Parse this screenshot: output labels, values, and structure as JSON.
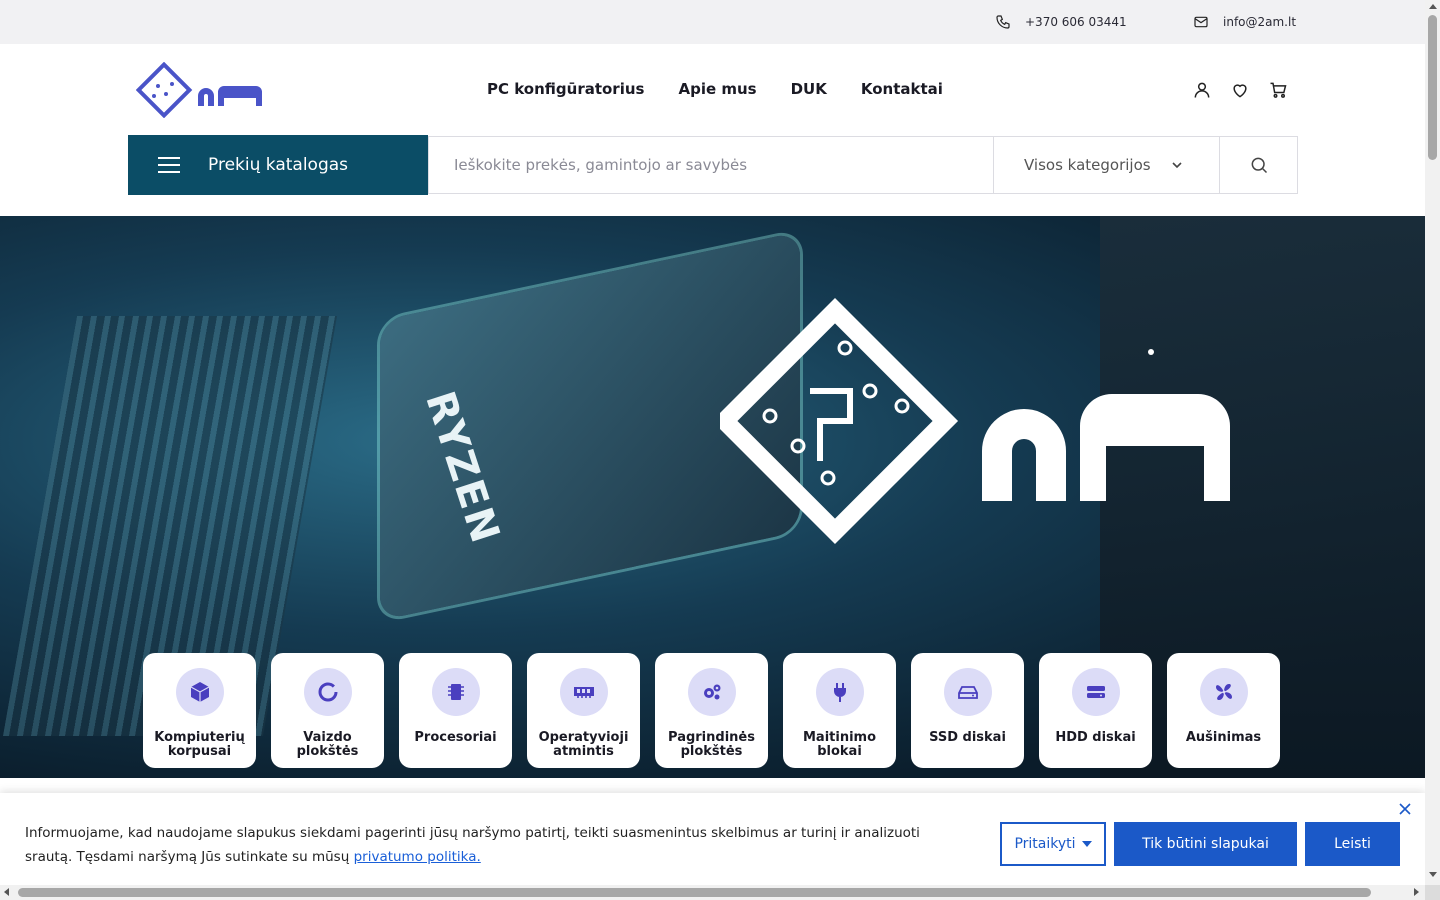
{
  "topbar": {
    "phone": "+370 606 03441",
    "email": "info@2am.lt"
  },
  "header": {
    "nav": [
      "PC konfigūratorius",
      "Apie mus",
      "DUK",
      "Kontaktai"
    ],
    "catalog_label": "Prekių katalogas",
    "search_placeholder": "Ieškokite prekės, gamintojo ar savybės",
    "category_selected": "Visos kategorijos"
  },
  "hero": {
    "cpu_text": "RYZEN"
  },
  "categories": [
    {
      "label": "Kompiuterių korpusai",
      "icon": "cube-icon"
    },
    {
      "label": "Vaizdo plokštės",
      "icon": "ring-icon"
    },
    {
      "label": "Procesoriai",
      "icon": "chip-icon"
    },
    {
      "label": "Operatyvioji atmintis",
      "icon": "ram-icon"
    },
    {
      "label": "Pagrindinės plokštės",
      "icon": "gears-icon"
    },
    {
      "label": "Maitinimo blokai",
      "icon": "plug-icon"
    },
    {
      "label": "SSD diskai",
      "icon": "drive-icon"
    },
    {
      "label": "HDD diskai",
      "icon": "hdd-icon"
    },
    {
      "label": "Aušinimas",
      "icon": "fan-icon"
    }
  ],
  "cookie": {
    "text": "Informuojame, kad naudojame slapukus siekdami pagerinti jūsų naršymo patirtį, teikti suasmenintus skelbimus ar turinį ir analizuoti srautą. Tęsdami naršymą Jūs sutinkate su mūsų",
    "link": "privatumo politika.",
    "customize": "Pritaikyti",
    "essential": "Tik būtini slapukai",
    "allow": "Leisti"
  },
  "colors": {
    "brand": "#0b4d66",
    "accent": "#1b59c8",
    "icon_bg": "#dcdcf7",
    "icon_fg": "#4a3fbf"
  }
}
